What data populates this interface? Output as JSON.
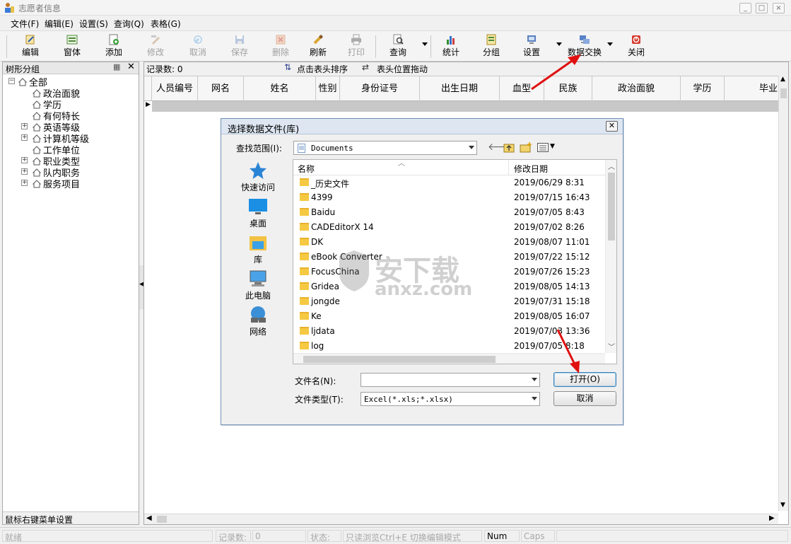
{
  "app": {
    "title": "志愿者信息"
  },
  "menu": [
    "文件(F)",
    "编辑(E)",
    "设置(S)",
    "查询(Q)",
    "表格(G)"
  ],
  "toolbar": {
    "buttons": [
      {
        "label": "编辑",
        "enabled": true
      },
      {
        "label": "窗体",
        "enabled": true
      },
      {
        "label": "添加",
        "enabled": true
      },
      {
        "label": "修改",
        "enabled": false
      },
      {
        "label": "取消",
        "enabled": false
      },
      {
        "label": "保存",
        "enabled": false
      },
      {
        "label": "删除",
        "enabled": false
      },
      {
        "label": "刷新",
        "enabled": true
      },
      {
        "label": "打印",
        "enabled": false
      },
      {
        "label": "查询",
        "enabled": true
      },
      {
        "label": "统计",
        "enabled": true
      },
      {
        "label": "分组",
        "enabled": true
      },
      {
        "label": "设置",
        "enabled": true
      },
      {
        "label": "数据交换",
        "enabled": true
      },
      {
        "label": "关闭",
        "enabled": true
      }
    ]
  },
  "tree": {
    "panel_title": "树形分组",
    "footer": "鼠标右键菜单设置",
    "root": "全部",
    "nodes": [
      {
        "label": "政治面貌",
        "expandable": false
      },
      {
        "label": "学历",
        "expandable": false
      },
      {
        "label": "有何特长",
        "expandable": false
      },
      {
        "label": "英语等级",
        "expandable": true
      },
      {
        "label": "计算机等级",
        "expandable": true
      },
      {
        "label": "工作单位",
        "expandable": false
      },
      {
        "label": "职业类型",
        "expandable": true
      },
      {
        "label": "队内职务",
        "expandable": true
      },
      {
        "label": "服务项目",
        "expandable": true
      }
    ]
  },
  "grid": {
    "record_count_label": "记录数: 0",
    "sort_hint": "点击表头排序",
    "drag_hint": "表头位置拖动",
    "columns": [
      "人员编号",
      "网名",
      "姓名",
      "性别",
      "身份证号",
      "出生日期",
      "血型",
      "民族",
      "政治面貌",
      "学历",
      "毕业"
    ]
  },
  "statusbar": {
    "state": "就绪",
    "record_label": "记录数:",
    "record_value": "0",
    "status_label": "状态:",
    "status_value": "只读浏览Ctrl+E 切换编辑模式",
    "num": "Num",
    "caps": "Caps"
  },
  "dialog": {
    "title": "选择数据文件(库)",
    "lookin_label": "查找范围(I):",
    "lookin_value": "Documents",
    "places": [
      "快速访问",
      "桌面",
      "库",
      "此电脑",
      "网络"
    ],
    "columns": {
      "name": "名称",
      "date": "修改日期"
    },
    "files": [
      {
        "name": "_历史文件",
        "date": "2019/06/29 8:31"
      },
      {
        "name": "4399",
        "date": "2019/07/15 16:43"
      },
      {
        "name": "Baidu",
        "date": "2019/07/05 8:43"
      },
      {
        "name": "CADEditorX 14",
        "date": "2019/07/02 8:26"
      },
      {
        "name": "DK",
        "date": "2019/08/07 11:01"
      },
      {
        "name": "eBook Converter",
        "date": "2019/07/22 15:12"
      },
      {
        "name": "FocusChina",
        "date": "2019/07/26 15:23"
      },
      {
        "name": "Gridea",
        "date": "2019/08/05 14:13"
      },
      {
        "name": "jongde",
        "date": "2019/07/31 15:18"
      },
      {
        "name": "Ke",
        "date": "2019/08/05 16:07"
      },
      {
        "name": "ljdata",
        "date": "2019/07/03 13:36"
      },
      {
        "name": "log",
        "date": "2019/07/05 8:18"
      }
    ],
    "filename_label": "文件名(N):",
    "filename_value": "",
    "filetype_label": "文件类型(T):",
    "filetype_value": "Excel(*.xls;*.xlsx)",
    "open_button": "打开(O)",
    "cancel_button": "取消"
  },
  "watermark": {
    "text_cn": "安下载",
    "text_en": "anxz.com"
  },
  "colors": {
    "annotation_arrow": "#e01010",
    "dialog_border": "#6f8fb5",
    "folder": "#f5c942"
  }
}
